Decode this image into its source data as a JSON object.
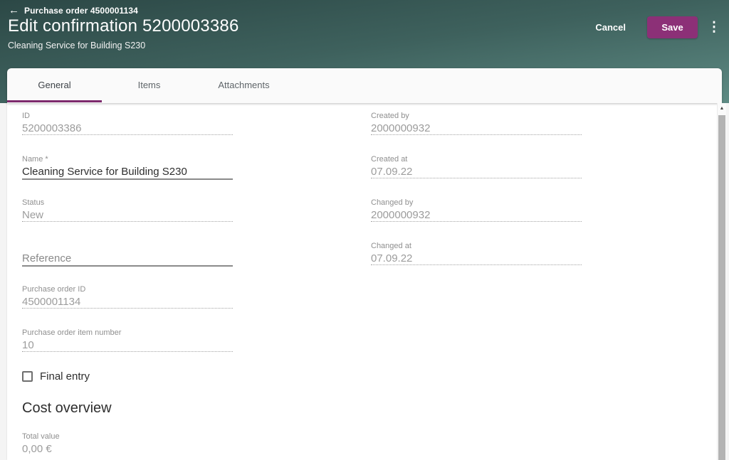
{
  "icons": {
    "back": "←",
    "overflow": "⋮",
    "scroll_up": "▲"
  },
  "colors": {
    "header_top": "#2c4846",
    "header_bottom": "#5e8b84",
    "accent_purple": "#8c3077",
    "tab_indicator": "#7d2a6d"
  },
  "header": {
    "back_label": "Purchase order 4500001134",
    "title": "Edit confirmation 5200003386",
    "subtitle": "Cleaning Service for Building S230",
    "cancel_label": "Cancel",
    "save_label": "Save"
  },
  "tabs": [
    {
      "label": "General",
      "active": true
    },
    {
      "label": "Items",
      "active": false
    },
    {
      "label": "Attachments",
      "active": false
    }
  ],
  "form": {
    "left": [
      {
        "label": "ID",
        "value": "5200003386",
        "disabled": true
      },
      {
        "label": "Name *",
        "value": "Cleaning Service for Building S230",
        "disabled": false
      },
      {
        "label": "Status",
        "value": "New",
        "disabled": true
      },
      {
        "label": "",
        "value": "",
        "placeholder": "Reference",
        "disabled": false
      },
      {
        "label": "Purchase order ID",
        "value": "4500001134",
        "disabled": true
      },
      {
        "label": "Purchase order item number",
        "value": "10",
        "disabled": true
      }
    ],
    "right": [
      {
        "label": "Created by",
        "value": "2000000932",
        "disabled": true
      },
      {
        "label": "Created at",
        "value": "07.09.22",
        "disabled": true
      },
      {
        "label": "Changed by",
        "value": "2000000932",
        "disabled": true
      },
      {
        "label": "Changed at",
        "value": "07.09.22",
        "disabled": true
      }
    ],
    "final_entry_label": "Final entry",
    "final_entry_checked": false
  },
  "cost_overview": {
    "heading": "Cost overview",
    "total_label": "Total value",
    "total_value": "0,00 €"
  }
}
